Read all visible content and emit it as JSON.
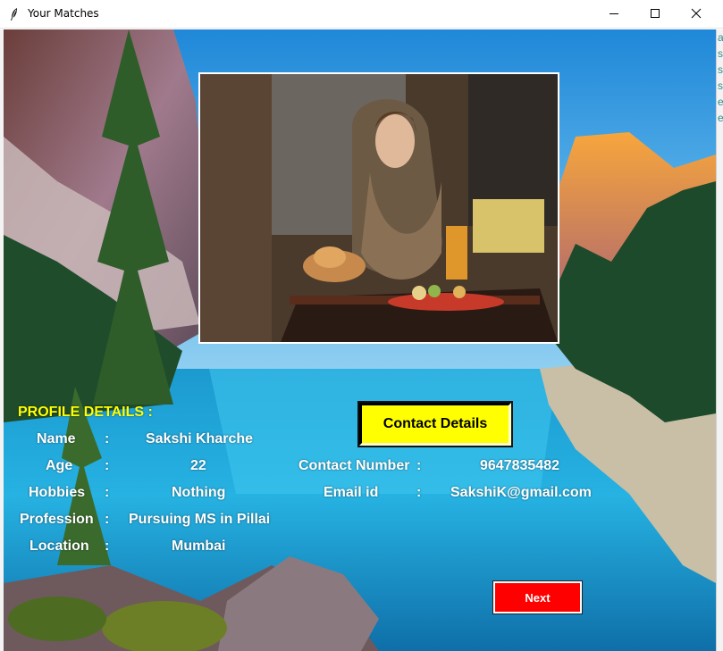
{
  "window": {
    "title": "Your Matches",
    "app_icon": "feather-icon",
    "controls": [
      "minimize-icon",
      "maximize-icon",
      "close-icon"
    ]
  },
  "right_strip": {
    "chars": [
      "ab",
      "s",
      "s",
      "s",
      "e",
      "e"
    ]
  },
  "profile": {
    "heading": "PROFILE DETAILS    :",
    "fields": [
      {
        "label": "Name",
        "sep": ":",
        "value": "Sakshi Kharche"
      },
      {
        "label": "Age",
        "sep": ":",
        "value": "22"
      },
      {
        "label": "Hobbies",
        "sep": ":",
        "value": "Nothing"
      },
      {
        "label": "Profession",
        "sep": ":",
        "value": "Pursuing MS in Pillai"
      },
      {
        "label": "Location",
        "sep": ":",
        "value": "Mumbai"
      }
    ]
  },
  "contact": {
    "button_label": "Contact Details",
    "number_label": "Contact Number",
    "number_sep": ":",
    "number_value": "9647835482",
    "email_label": "Email id",
    "email_sep": ":",
    "email_value": "SakshiK@gmail.com"
  },
  "next_button_label": "Next",
  "colors": {
    "heading": "#ffff00",
    "text": "#ffffff",
    "contact_button": "#ffff00",
    "next_button": "#ff0000"
  }
}
